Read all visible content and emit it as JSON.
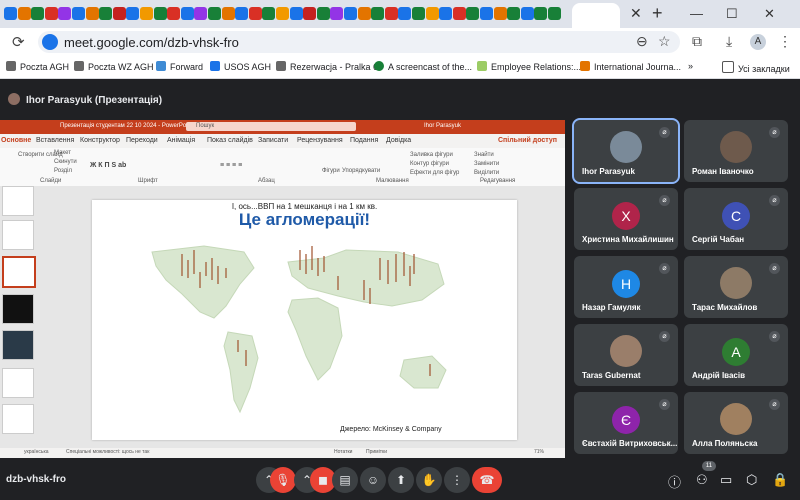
{
  "browser": {
    "url": "meet.google.com/dzb-vhsk-fro",
    "bookmarks": [
      "Poczta AGH",
      "Poczta WZ AGH",
      "Forward",
      "USOS AGH",
      "Rezerwacja - Pralka 6",
      "A screencast of the...",
      "Employee Relations:...",
      "International Journa...",
      "Усі закладки"
    ],
    "avatar_letter": "A",
    "tab_colors": [
      "#1a73e8",
      "#e37400",
      "#188038",
      "#d93025",
      "#9334e6",
      "#1a73e8",
      "#e37400",
      "#188038",
      "#c5221f",
      "#1a73e8",
      "#f29900",
      "#188038",
      "#d93025",
      "#1a73e8",
      "#9334e6",
      "#188038",
      "#e37400",
      "#1a73e8",
      "#d93025",
      "#188038",
      "#f29900",
      "#1a73e8",
      "#c5221f",
      "#188038",
      "#9334e6",
      "#1a73e8",
      "#e37400",
      "#188038",
      "#d93025",
      "#1a73e8",
      "#188038",
      "#f29900",
      "#1a73e8",
      "#d93025",
      "#188038",
      "#1a73e8",
      "#e37400",
      "#188038",
      "#1a73e8",
      "#188038",
      "#188038"
    ]
  },
  "meet": {
    "presenter_label": "Ihor Parasyuk (Презентація)",
    "meeting_code": "dzb-vhsk-fro",
    "participant_count": "11",
    "tiles": [
      {
        "name": "Ihor Parasyuk",
        "type": "photo",
        "color": "#7a8a99"
      },
      {
        "name": "Роман Іваночко",
        "type": "photo",
        "color": "#6e5a4c"
      },
      {
        "name": "Христина Михайлишин",
        "type": "letter",
        "letter": "Х",
        "color": "#b0244a"
      },
      {
        "name": "Сергій Чабан",
        "type": "letter",
        "letter": "С",
        "color": "#3f51b5"
      },
      {
        "name": "Назар Гамуляк",
        "type": "letter",
        "letter": "Н",
        "color": "#1e88e5"
      },
      {
        "name": "Тарас Михайлов",
        "type": "photo",
        "color": "#8d7a66"
      },
      {
        "name": "Taras Gubernat",
        "type": "photo",
        "color": "#9a7e6a"
      },
      {
        "name": "Андрій Івасів",
        "type": "letter",
        "letter": "А",
        "color": "#2e7d32"
      },
      {
        "name": "Євстахій Витриховськ...",
        "type": "letter",
        "letter": "Є",
        "color": "#8e24aa"
      },
      {
        "name": "Алла Поляньска",
        "type": "photo",
        "color": "#a08060"
      }
    ]
  },
  "powerpoint": {
    "window_title": "Презентація студентам 22 10 2024 - PowerPoint",
    "search_placeholder": "Пошук",
    "user": "Ihor Parasyuk",
    "share_button": "Спільний доступ",
    "tabs": [
      "Основне",
      "Вставлення",
      "Конструктор",
      "Переходи",
      "Анімація",
      "Показ слайдів",
      "Записати",
      "Рецензування",
      "Подання",
      "Довідка"
    ],
    "ribbon_groups": [
      "Слайди",
      "Шрифт",
      "Абзац",
      "Малювання",
      "Редагування"
    ],
    "ribbon_buttons": [
      "Створити слайд",
      "Макет",
      "Скинути",
      "Розділ",
      "Фігури",
      "Упорядкувати",
      "Заливка фігури",
      "Контур фігури",
      "Ефекти для фігур",
      "Знайти",
      "Замінити",
      "Виділити"
    ],
    "slide_subtitle": "І, ось...ВВП на 1 мешканця і на 1 км кв.",
    "slide_title": "Це агломерації!",
    "slide_source": "Джерело: McKinsey & Company",
    "status_lang": "українська",
    "status_access": "Спеціальні можливості: щось не так",
    "status_notes": "Нотатки",
    "status_comments": "Примітки",
    "zoom": "71%"
  }
}
